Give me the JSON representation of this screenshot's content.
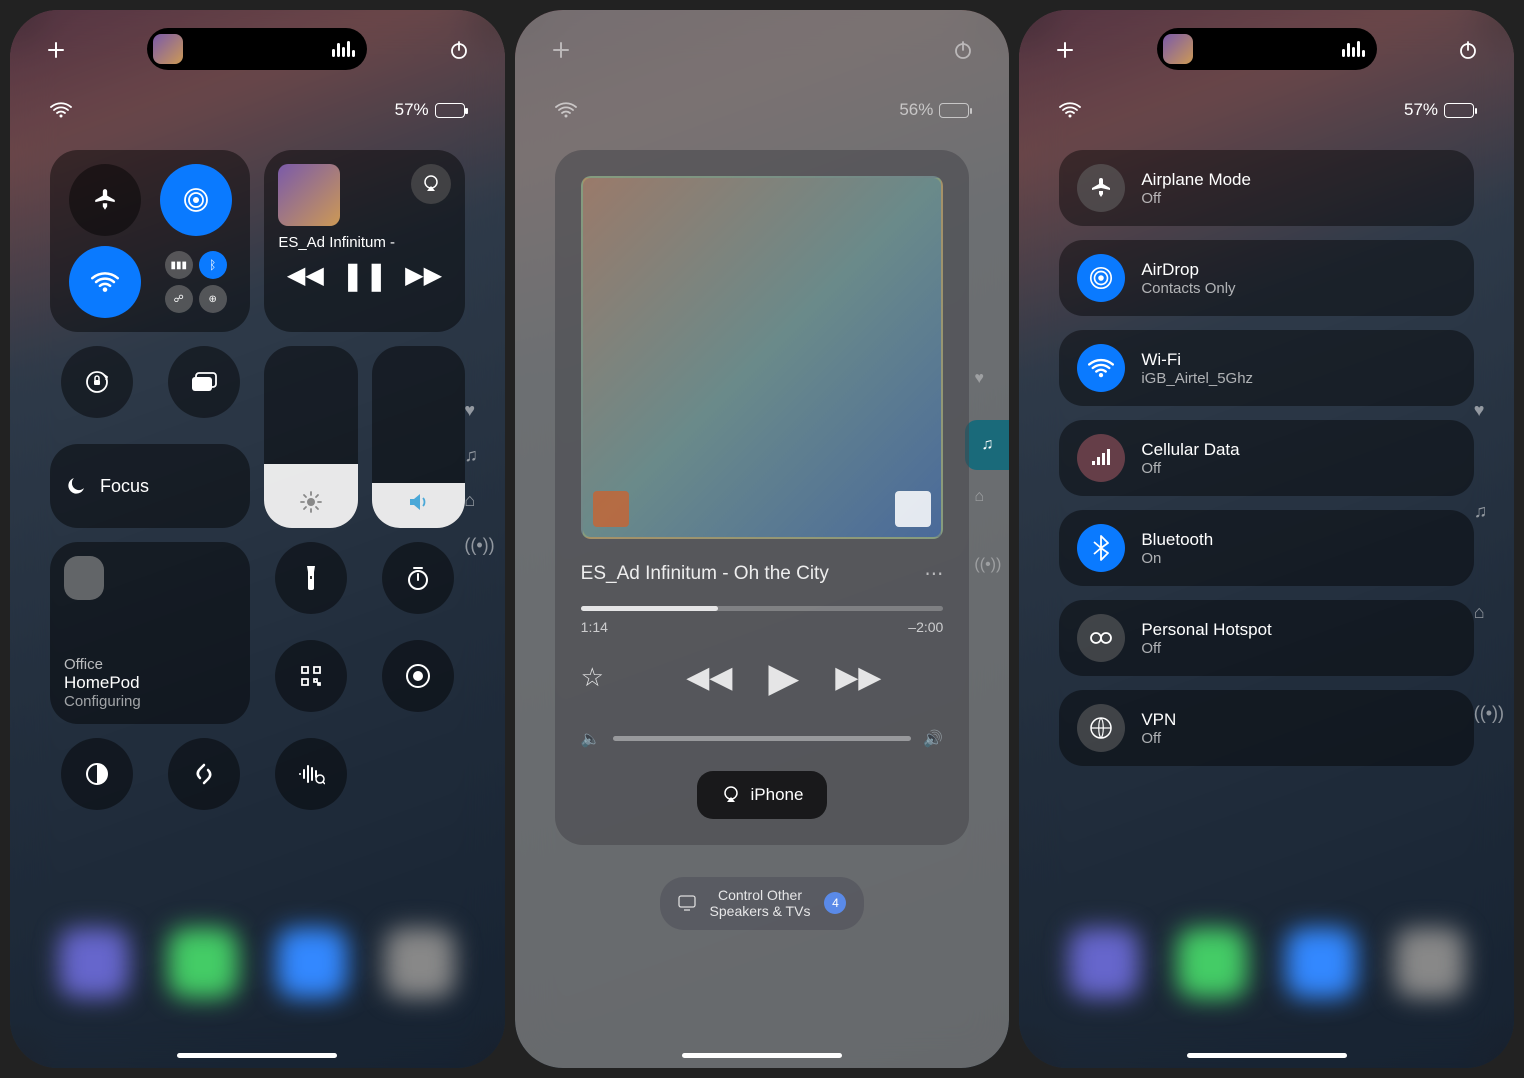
{
  "panel1": {
    "battery": "57%",
    "battery_level": 57,
    "music": {
      "title": "ES_Ad Infinitum -"
    },
    "focus_label": "Focus",
    "brightness_level": 35,
    "volume_level": 25,
    "home": {
      "room": "Office",
      "device": "HomePod",
      "status": "Configuring"
    }
  },
  "panel2": {
    "battery": "56%",
    "track": "ES_Ad Infinitum - Oh the City",
    "elapsed": "1:14",
    "remaining": "–2:00",
    "progress_pct": 38,
    "output_label": "iPhone",
    "other_speakers_label": "Control Other\nSpeakers & TVs",
    "other_speakers_count": "4"
  },
  "panel3": {
    "battery": "57%",
    "items": [
      {
        "id": "airplane",
        "title": "Airplane Mode",
        "sub": "Off",
        "on": false
      },
      {
        "id": "airdrop",
        "title": "AirDrop",
        "sub": "Contacts Only",
        "on": true
      },
      {
        "id": "wifi",
        "title": "Wi-Fi",
        "sub": "iGB_Airtel_5Ghz",
        "on": true
      },
      {
        "id": "cellular",
        "title": "Cellular Data",
        "sub": "Off",
        "on": false
      },
      {
        "id": "bluetooth",
        "title": "Bluetooth",
        "sub": "On",
        "on": true
      },
      {
        "id": "hotspot",
        "title": "Personal Hotspot",
        "sub": "Off",
        "on": false
      },
      {
        "id": "vpn",
        "title": "VPN",
        "sub": "Off",
        "on": false
      }
    ]
  }
}
